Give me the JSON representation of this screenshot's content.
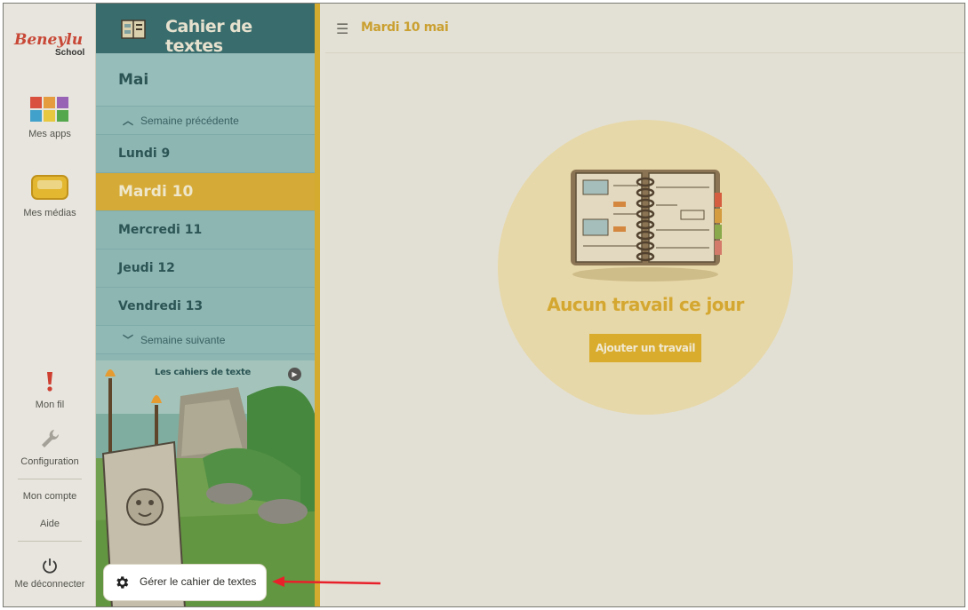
{
  "rail": {
    "logo": "Beneylu School",
    "apps_label": "Mes apps",
    "medias_label": "Mes médias",
    "feed_label": "Mon fil",
    "config_label": "Configuration",
    "account_label": "Mon compte",
    "help_label": "Aide",
    "logout_label": "Me déconnecter"
  },
  "sidebar": {
    "title": "Cahier de textes",
    "month": "Mai",
    "prev_week": "Semaine précédente",
    "next_week": "Semaine suivante",
    "days": [
      "Lundi 9",
      "Mardi 10",
      "Mercredi 11",
      "Jeudi 12",
      "Vendredi 13"
    ],
    "active_day": "Mardi 10",
    "illustration_title": "Les cahiers de texte",
    "manage_button": "Gérer le cahier de textes"
  },
  "topbar": {
    "current_date": "Mardi 10 mai"
  },
  "main": {
    "empty_message": "Aucun travail ce jour",
    "add_button": "Ajouter un travail"
  },
  "icons": {
    "menu": "hamburger-icon",
    "apps": "apps-grid-icon",
    "medias": "tray-icon",
    "feed": "exclamation-icon",
    "config": "wrench-icon",
    "logout": "power-icon",
    "manage": "gear-icon",
    "prev": "chevron-up-icon",
    "next": "chevron-down-icon"
  },
  "colors": {
    "accent": "#e2b12f",
    "sidebar_header": "#2f6b6e",
    "sidebar": "#8fbfbe",
    "callout_arrow": "#e8202a"
  }
}
